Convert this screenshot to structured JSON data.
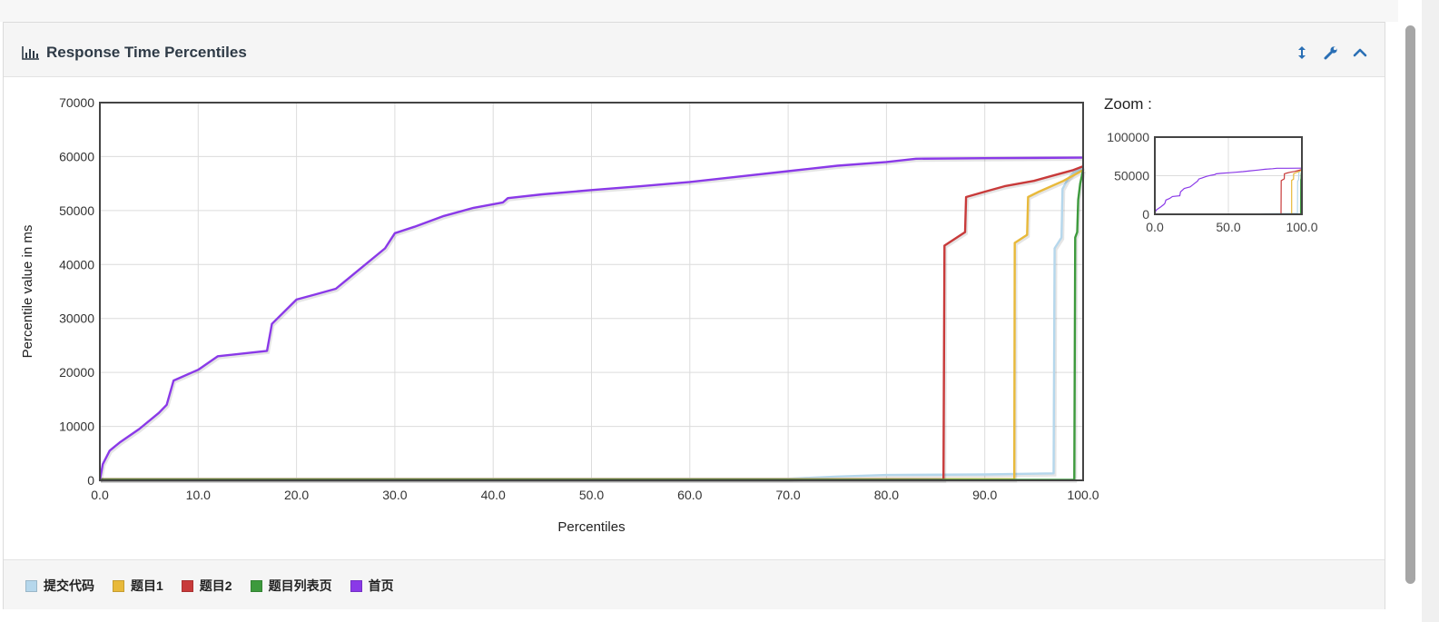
{
  "panel": {
    "title": "Response Time Percentiles",
    "icons": [
      "bar-chart-icon",
      "resize-vertical-icon",
      "wrench-icon",
      "chevron-up-icon"
    ]
  },
  "zoom_label": "Zoom :",
  "chart_data": {
    "type": "line",
    "xlabel": "Percentiles",
    "ylabel": "Percentile value in ms",
    "xlim": [
      0,
      100
    ],
    "ylim": [
      0,
      70000
    ],
    "xticks": [
      "0.0",
      "10.0",
      "20.0",
      "30.0",
      "40.0",
      "50.0",
      "60.0",
      "70.0",
      "80.0",
      "90.0",
      "100.0"
    ],
    "yticks": [
      "0",
      "10000",
      "20000",
      "30000",
      "40000",
      "50000",
      "60000",
      "70000"
    ],
    "grid": true,
    "legend_position": "bottom",
    "series": [
      {
        "name": "提交代码",
        "color": "#b5d7ec",
        "points": [
          [
            0,
            300
          ],
          [
            70,
            300
          ],
          [
            75,
            700
          ],
          [
            80,
            1000
          ],
          [
            90,
            1100
          ],
          [
            97,
            1300
          ],
          [
            97.1,
            43000
          ],
          [
            97.8,
            45000
          ],
          [
            97.9,
            54000
          ],
          [
            98.5,
            56000
          ],
          [
            99,
            57000
          ],
          [
            100,
            58000
          ]
        ]
      },
      {
        "name": "题目1",
        "color": "#e8b93a",
        "points": [
          [
            0,
            200
          ],
          [
            93,
            200
          ],
          [
            93.05,
            44000
          ],
          [
            94.3,
            45500
          ],
          [
            94.4,
            52500
          ],
          [
            95.5,
            53500
          ],
          [
            98,
            55500
          ],
          [
            99,
            56500
          ],
          [
            100,
            57500
          ]
        ]
      },
      {
        "name": "题目2",
        "color": "#c83a3a",
        "points": [
          [
            0,
            150
          ],
          [
            85.8,
            150
          ],
          [
            85.9,
            43500
          ],
          [
            88,
            46000
          ],
          [
            88.1,
            52500
          ],
          [
            90,
            53500
          ],
          [
            92,
            54500
          ],
          [
            95,
            55500
          ],
          [
            97,
            56500
          ],
          [
            99,
            57500
          ],
          [
            100,
            58200
          ]
        ]
      },
      {
        "name": "题目列表页",
        "color": "#3d9a3d",
        "points": [
          [
            0,
            100
          ],
          [
            99.1,
            100
          ],
          [
            99.2,
            45000
          ],
          [
            99.4,
            46000
          ],
          [
            99.5,
            52000
          ],
          [
            99.7,
            55000
          ],
          [
            100,
            57500
          ]
        ]
      },
      {
        "name": "首页",
        "color": "#8a39e8",
        "points": [
          [
            0,
            0
          ],
          [
            0.3,
            3000
          ],
          [
            1,
            5500
          ],
          [
            2,
            7000
          ],
          [
            4,
            9500
          ],
          [
            6,
            12500
          ],
          [
            6.8,
            14000
          ],
          [
            7.5,
            18500
          ],
          [
            10,
            20500
          ],
          [
            12,
            23000
          ],
          [
            17,
            24000
          ],
          [
            17.5,
            29000
          ],
          [
            20,
            33500
          ],
          [
            22,
            34500
          ],
          [
            24,
            35500
          ],
          [
            26,
            38500
          ],
          [
            29,
            43000
          ],
          [
            30,
            45800
          ],
          [
            32,
            47000
          ],
          [
            35,
            49000
          ],
          [
            38,
            50500
          ],
          [
            41,
            51500
          ],
          [
            41.5,
            52300
          ],
          [
            45,
            53000
          ],
          [
            50,
            53800
          ],
          [
            55,
            54500
          ],
          [
            60,
            55300
          ],
          [
            65,
            56300
          ],
          [
            70,
            57300
          ],
          [
            75,
            58300
          ],
          [
            80,
            59000
          ],
          [
            83,
            59600
          ],
          [
            90,
            59700
          ],
          [
            100,
            59800
          ]
        ]
      }
    ]
  },
  "zoom_chart": {
    "xticks": [
      "0.0",
      "50.0",
      "100.0"
    ],
    "yticks": [
      "0",
      "50000",
      "100000"
    ],
    "xlim": [
      0,
      100
    ],
    "ylim": [
      0,
      100000
    ]
  }
}
